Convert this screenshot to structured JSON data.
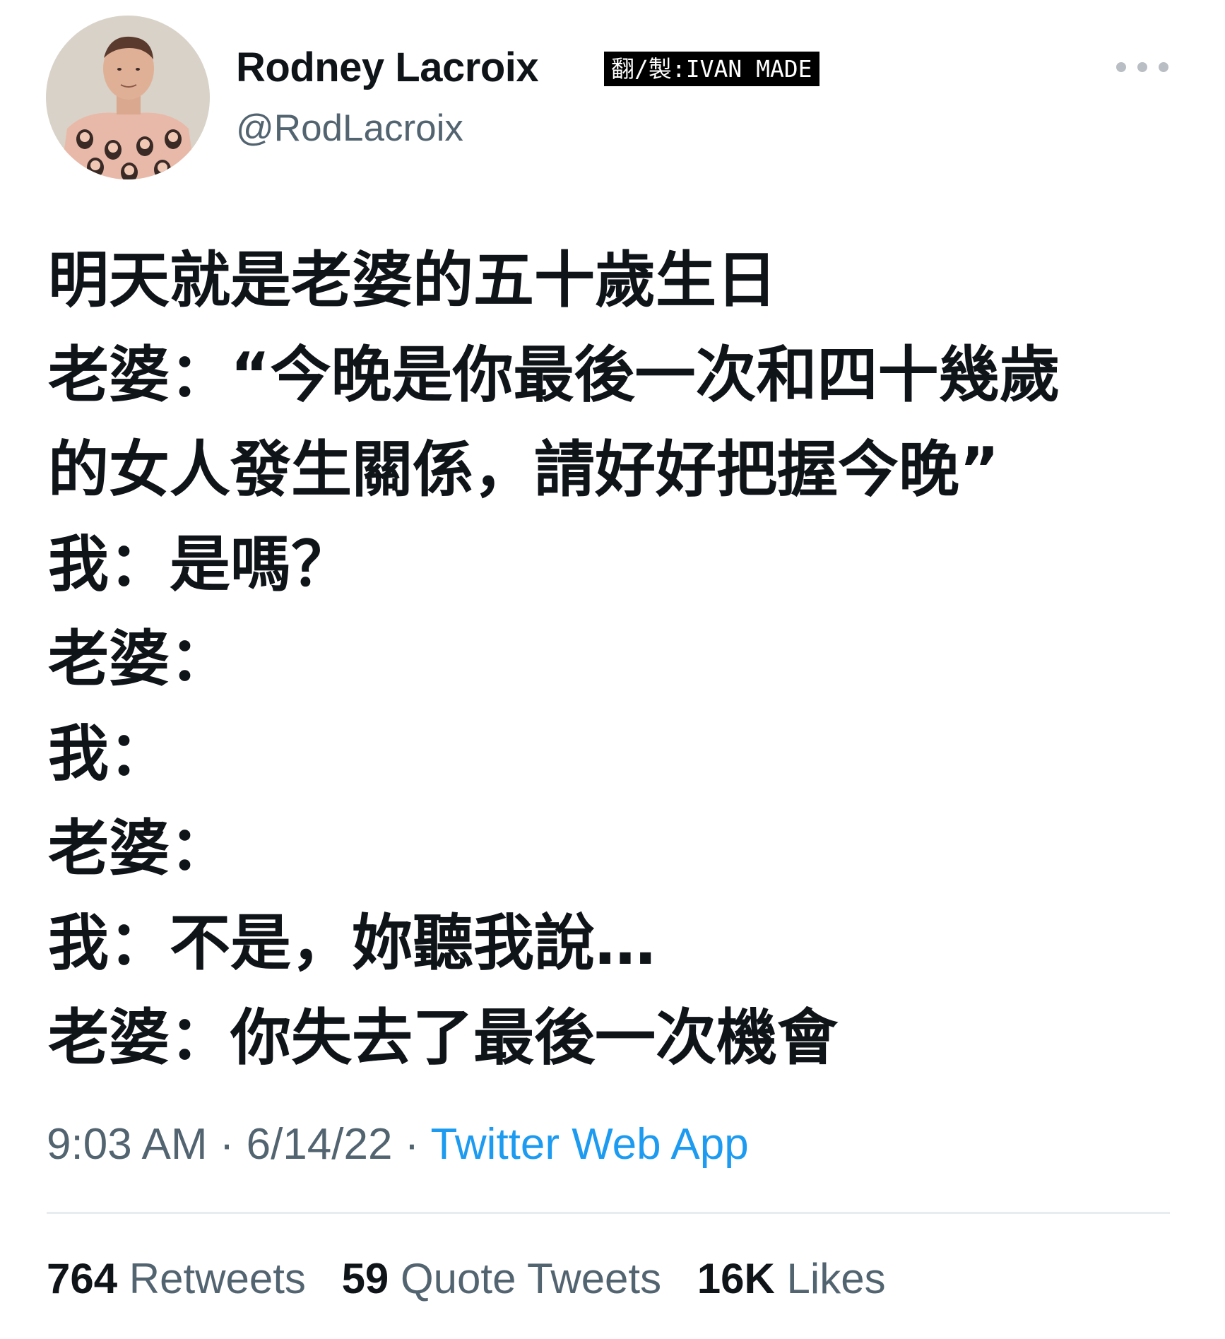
{
  "author": {
    "display_name": "Rodney Lacroix",
    "handle": "@RodLacroix"
  },
  "watermark": "翻/製:IVAN MADE",
  "tweet": {
    "lines": [
      "明天就是老婆的五十歲生日",
      "老婆：“今晚是你最後一次和四十幾歲",
      "的女人發生關係，請好好把握今晚”",
      "我：是嗎？",
      "老婆：",
      "我：",
      "老婆：",
      "我：不是，妳聽我說…",
      "老婆：你失去了最後一次機會"
    ]
  },
  "meta": {
    "time": "9:03 AM",
    "date": "6/14/22",
    "separator": " · ",
    "source": "Twitter Web App"
  },
  "stats": {
    "retweets_count": "764",
    "retweets_label": "Retweets",
    "quotes_count": "59",
    "quotes_label": "Quote Tweets",
    "likes_count": "16K",
    "likes_label": "Likes"
  },
  "icons": {
    "more": "more-horizontal-icon"
  },
  "colors": {
    "text_primary": "#0f1419",
    "text_secondary": "#536471",
    "link": "#1d9bf0",
    "divider": "#e6ecf0"
  }
}
